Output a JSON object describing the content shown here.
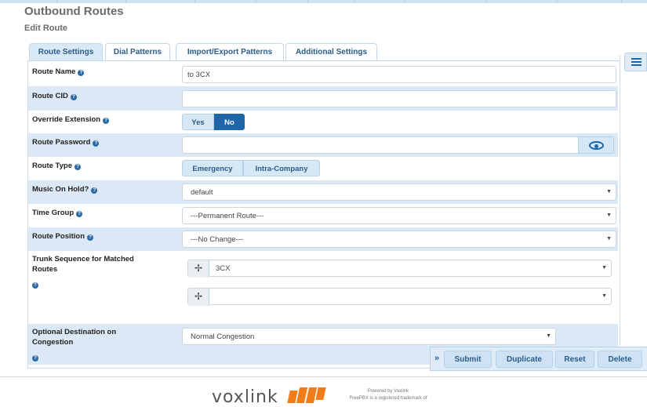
{
  "page": {
    "title": "Outbound Routes",
    "subtitle": "Edit Route"
  },
  "tabs": [
    {
      "label": "Route Settings",
      "active": true
    },
    {
      "label": "Dial Patterns",
      "active": false
    },
    {
      "label": "Import/Export Patterns",
      "active": false
    },
    {
      "label": "Additional Settings",
      "active": false
    }
  ],
  "form": {
    "route_name": {
      "label": "Route Name",
      "value": "to 3CX"
    },
    "route_cid": {
      "label": "Route CID",
      "value": ""
    },
    "override_extension": {
      "label": "Override Extension",
      "options": [
        "Yes",
        "No"
      ],
      "selected": "No"
    },
    "route_password": {
      "label": "Route Password",
      "value": ""
    },
    "route_type": {
      "label": "Route Type",
      "options": [
        "Emergency",
        "Intra-Company"
      ]
    },
    "music_on_hold": {
      "label": "Music On Hold?",
      "value": "default"
    },
    "time_group": {
      "label": "Time Group",
      "value": "---Permanent Route---"
    },
    "route_position": {
      "label": "Route Position",
      "value": "---No Change---"
    },
    "trunk_sequence": {
      "label": "Trunk Sequence for Matched Routes",
      "trunks": [
        "3CX",
        ""
      ]
    },
    "optional_destination": {
      "label": "Optional Destination on Congestion",
      "value": "Normal Congestion"
    }
  },
  "help_glyph": "?",
  "actions": {
    "expand": "»",
    "buttons": [
      "Submit",
      "Duplicate",
      "Reset",
      "Delete"
    ]
  },
  "footer": {
    "logo_text": "voxlink",
    "powered_by": "Powered by Voxlink",
    "trademark": "FreePBX is a registered trademark of"
  },
  "colors": {
    "accent": "#1f66a8",
    "row_shade": "#dbe8f5",
    "logo_orange": "#f07d1a"
  }
}
